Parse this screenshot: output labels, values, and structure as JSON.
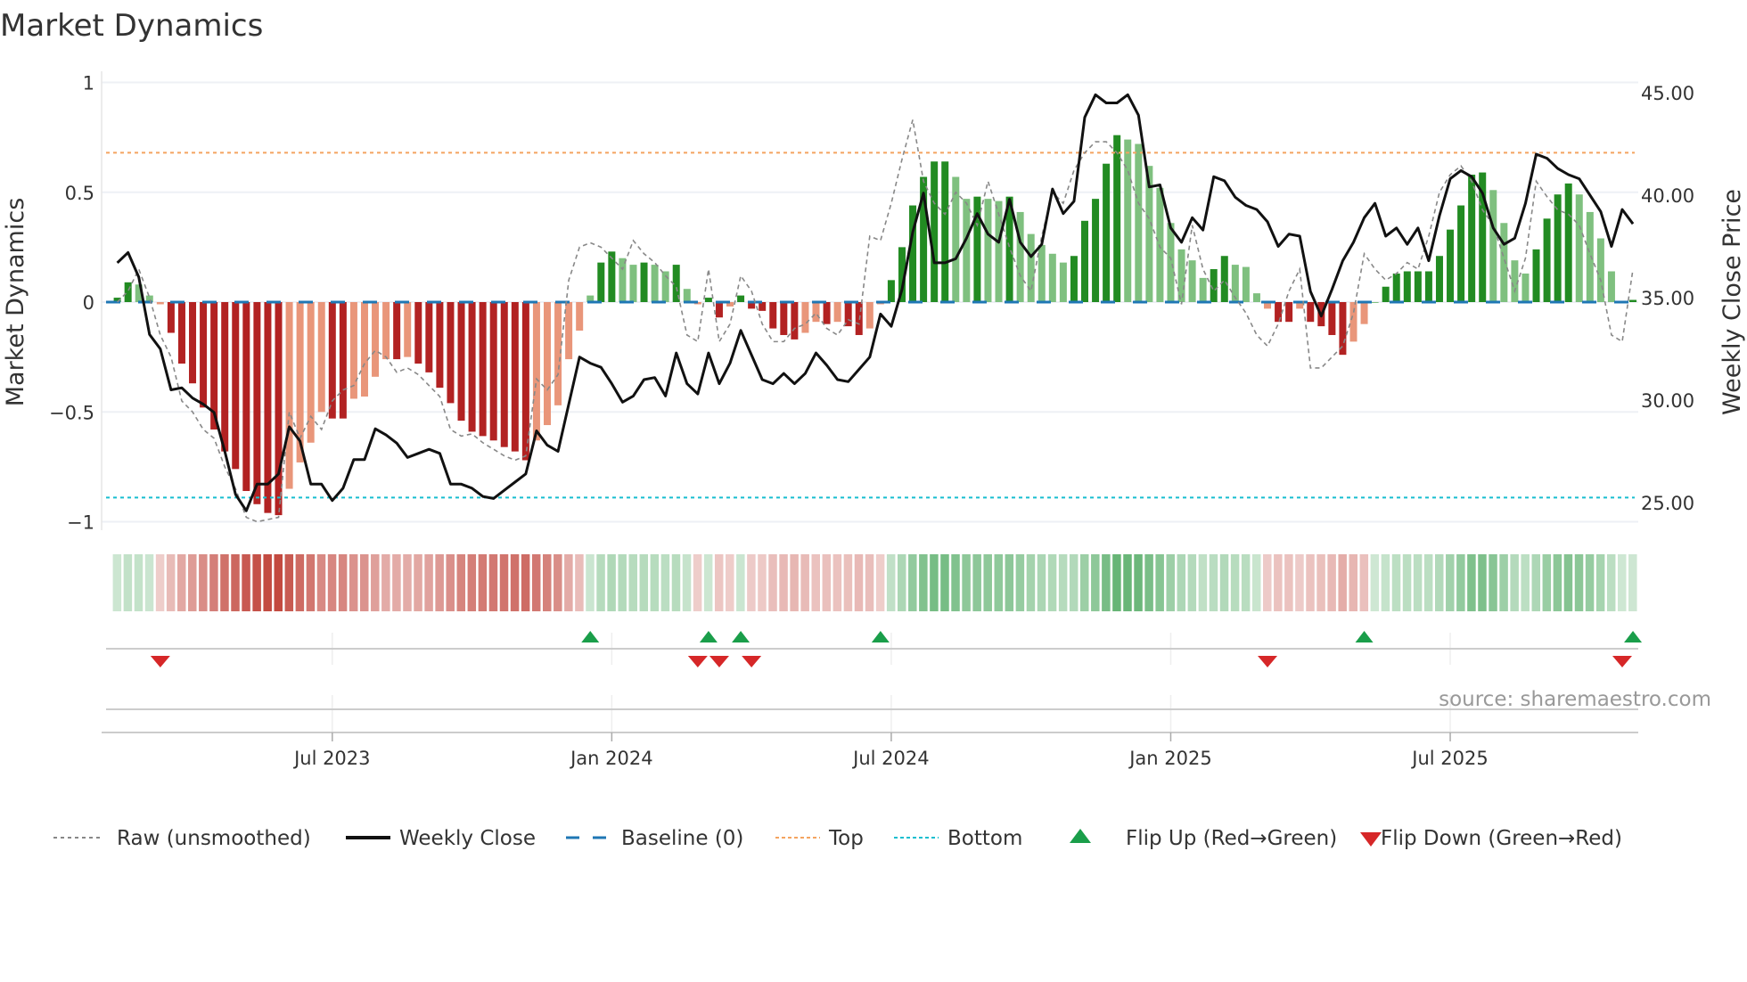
{
  "title": "Market Dynamics",
  "source": "source: sharemaestro.com",
  "chart_data": {
    "type": "bar",
    "title": "Market Dynamics",
    "xlabel": "",
    "ylabel": "Market Dynamics",
    "y2label": "Weekly Close Price",
    "ylim": [
      -1.05,
      1.0
    ],
    "y2lim": [
      24.1,
      45.6
    ],
    "yticks": [
      {
        "v": 1,
        "label": "1"
      },
      {
        "v": 0.5,
        "label": "0.5"
      },
      {
        "v": 0,
        "label": "0"
      },
      {
        "v": -0.5,
        "label": "−0.5"
      },
      {
        "v": -1,
        "label": "−1"
      }
    ],
    "y2ticks": [
      {
        "v": 45,
        "label": "45.00"
      },
      {
        "v": 40,
        "label": "40.00"
      },
      {
        "v": 35,
        "label": "35.00"
      },
      {
        "v": 30,
        "label": "30.00"
      },
      {
        "v": 25,
        "label": "25.00"
      }
    ],
    "xticks": [
      {
        "week": 20,
        "label": "Jul 2023"
      },
      {
        "week": 46,
        "label": "Jan 2024"
      },
      {
        "week": 72,
        "label": "Jul 2024"
      },
      {
        "week": 98,
        "label": "Jan 2025"
      },
      {
        "week": 124,
        "label": "Jul 2025"
      }
    ],
    "top_level": 0.68,
    "bottom_level": -0.89,
    "baseline": 0,
    "colors": {
      "up_dark": "#228b22",
      "up_light": "#7fc07f",
      "down_dark": "#b22222",
      "down_light": "#e9967a",
      "close": "#111111",
      "raw": "#888888",
      "baseline": "#1f77b4",
      "top": "#f4a460",
      "bottom": "#17becf",
      "flip_up": "#1a9e4a",
      "flip_down": "#d62728"
    },
    "dynamics": [
      0.02,
      0.09,
      0.08,
      0.03,
      -0.01,
      -0.14,
      -0.28,
      -0.37,
      -0.48,
      -0.58,
      -0.68,
      -0.76,
      -0.86,
      -0.92,
      -0.96,
      -0.97,
      -0.85,
      -0.73,
      -0.64,
      -0.5,
      -0.53,
      -0.53,
      -0.44,
      -0.43,
      -0.34,
      -0.26,
      -0.26,
      -0.25,
      -0.28,
      -0.32,
      -0.39,
      -0.46,
      -0.54,
      -0.59,
      -0.61,
      -0.63,
      -0.66,
      -0.68,
      -0.72,
      -0.63,
      -0.56,
      -0.47,
      -0.26,
      -0.13,
      0.03,
      0.18,
      0.23,
      0.2,
      0.17,
      0.18,
      0.17,
      0.14,
      0.17,
      0.06,
      -0.01,
      0.02,
      -0.07,
      -0.02,
      0.03,
      -0.03,
      -0.04,
      -0.12,
      -0.15,
      -0.17,
      -0.14,
      -0.09,
      -0.1,
      -0.09,
      -0.11,
      -0.15,
      -0.12,
      -0.01,
      0.1,
      0.25,
      0.44,
      0.57,
      0.64,
      0.64,
      0.57,
      0.47,
      0.48,
      0.47,
      0.46,
      0.48,
      0.41,
      0.31,
      0.26,
      0.22,
      0.18,
      0.21,
      0.37,
      0.47,
      0.63,
      0.76,
      0.74,
      0.72,
      0.62,
      0.52,
      0.36,
      0.24,
      0.19,
      0.11,
      0.15,
      0.21,
      0.17,
      0.16,
      0.04,
      -0.03,
      -0.09,
      -0.09,
      -0.03,
      -0.09,
      -0.11,
      -0.15,
      -0.24,
      -0.18,
      -0.1,
      0.0,
      0.07,
      0.13,
      0.14,
      0.14,
      0.14,
      0.21,
      0.33,
      0.44,
      0.58,
      0.59,
      0.51,
      0.36,
      0.19,
      0.13,
      0.24,
      0.38,
      0.49,
      0.54,
      0.49,
      0.41,
      0.29,
      0.14,
      0.0,
      0.01
    ],
    "raw": [
      0.0,
      0.05,
      0.15,
      0.02,
      -0.15,
      -0.25,
      -0.45,
      -0.5,
      -0.58,
      -0.62,
      -0.75,
      -0.85,
      -0.98,
      -1.0,
      -0.99,
      -0.98,
      -0.5,
      -0.62,
      -0.52,
      -0.58,
      -0.45,
      -0.4,
      -0.38,
      -0.28,
      -0.22,
      -0.25,
      -0.32,
      -0.3,
      -0.33,
      -0.38,
      -0.43,
      -0.58,
      -0.61,
      -0.6,
      -0.64,
      -0.67,
      -0.7,
      -0.72,
      -0.7,
      -0.35,
      -0.4,
      -0.33,
      0.1,
      0.25,
      0.27,
      0.25,
      0.2,
      0.15,
      0.28,
      0.22,
      0.18,
      0.12,
      0.07,
      -0.15,
      -0.18,
      0.15,
      -0.18,
      -0.1,
      0.12,
      0.05,
      -0.1,
      -0.18,
      -0.18,
      -0.12,
      -0.1,
      -0.05,
      -0.12,
      -0.15,
      -0.08,
      -0.1,
      0.3,
      0.28,
      0.45,
      0.65,
      0.83,
      0.55,
      0.45,
      0.4,
      0.5,
      0.45,
      0.35,
      0.55,
      0.4,
      0.25,
      0.12,
      0.05,
      0.3,
      0.5,
      0.45,
      0.6,
      0.68,
      0.73,
      0.73,
      0.68,
      0.6,
      0.45,
      0.38,
      0.25,
      0.2,
      -0.01,
      0.35,
      0.15,
      0.05,
      0.1,
      0.02,
      -0.05,
      -0.15,
      -0.2,
      -0.1,
      0.05,
      0.15,
      -0.3,
      -0.3,
      -0.25,
      -0.2,
      -0.05,
      0.22,
      0.15,
      0.1,
      0.13,
      0.18,
      0.15,
      0.3,
      0.5,
      0.58,
      0.62,
      0.55,
      0.42,
      0.35,
      0.2,
      0.05,
      0.2,
      0.55,
      0.48,
      0.42,
      0.4,
      0.35,
      0.22,
      0.1,
      -0.15,
      -0.18,
      0.15
    ],
    "weekly_close": [
      36.7,
      37.2,
      36.0,
      33.2,
      32.5,
      30.5,
      30.6,
      30.1,
      29.8,
      29.4,
      27.5,
      25.4,
      24.6,
      25.9,
      25.9,
      26.4,
      28.7,
      28.0,
      25.9,
      25.9,
      25.1,
      25.7,
      27.1,
      27.1,
      28.6,
      28.3,
      27.9,
      27.2,
      27.4,
      27.6,
      27.4,
      25.9,
      25.9,
      25.7,
      25.3,
      25.2,
      25.6,
      26.0,
      26.4,
      28.5,
      27.8,
      27.5,
      29.8,
      32.1,
      31.8,
      31.6,
      30.8,
      29.9,
      30.2,
      31.0,
      31.1,
      30.2,
      32.3,
      30.8,
      30.3,
      32.3,
      30.8,
      31.8,
      33.4,
      32.2,
      31.0,
      30.8,
      31.3,
      30.8,
      31.3,
      32.3,
      31.7,
      31.0,
      30.9,
      31.5,
      32.1,
      34.2,
      33.6,
      35.4,
      38.2,
      40.1,
      36.7,
      36.7,
      36.9,
      37.9,
      39.1,
      38.1,
      37.7,
      39.8,
      37.7,
      37.0,
      37.6,
      40.3,
      39.1,
      39.7,
      43.8,
      44.9,
      44.5,
      44.5,
      44.9,
      43.9,
      40.4,
      40.5,
      38.4,
      37.7,
      38.9,
      38.3,
      40.9,
      40.7,
      39.9,
      39.5,
      39.3,
      38.7,
      37.5,
      38.1,
      38.0,
      35.3,
      34.1,
      35.4,
      36.8,
      37.7,
      38.9,
      39.6,
      38.0,
      38.4,
      37.6,
      38.4,
      36.8,
      39.0,
      40.8,
      41.2,
      40.9,
      40.1,
      38.4,
      37.6,
      37.9,
      39.6,
      42.0,
      41.8,
      41.3,
      41.0,
      40.8,
      40.0,
      39.2,
      37.5,
      39.3,
      38.6
    ],
    "flip_up_weeks": [
      44,
      55,
      58,
      71,
      116,
      141
    ],
    "flip_down_weeks": [
      4,
      54,
      56,
      59,
      107,
      140
    ],
    "legend_position": "bottom",
    "legend": [
      {
        "key": "raw",
        "label": "Raw (unsmoothed)"
      },
      {
        "key": "close",
        "label": "Weekly Close"
      },
      {
        "key": "baseline",
        "label": "Baseline (0)"
      },
      {
        "key": "top",
        "label": "Top"
      },
      {
        "key": "bottom",
        "label": "Bottom"
      },
      {
        "key": "flip_up",
        "label": "Flip Up (Red→Green)"
      },
      {
        "key": "flip_down",
        "label": "Flip Down (Green→Red)"
      }
    ]
  }
}
